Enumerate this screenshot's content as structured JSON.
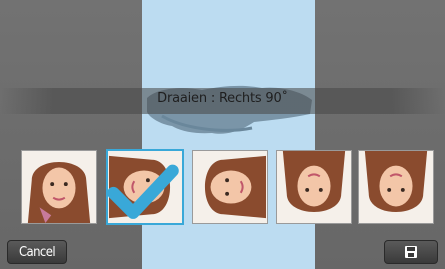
{
  "banner": {
    "text": "Draaien : Rechts 90˚"
  },
  "thumbnails": [
    {
      "id": "thumb-original",
      "rotation": 0
    },
    {
      "id": "thumb-right-90",
      "rotation": 90,
      "selected": true
    },
    {
      "id": "thumb-left-90",
      "rotation": -90
    },
    {
      "id": "thumb-180",
      "rotation": 180
    },
    {
      "id": "thumb-flip",
      "rotation": 180
    }
  ],
  "buttons": {
    "cancel_label": "Cancel",
    "save_icon": "save-icon"
  },
  "colors": {
    "accent": "#39a8d8",
    "preview_bg": "#bcdcf1"
  }
}
